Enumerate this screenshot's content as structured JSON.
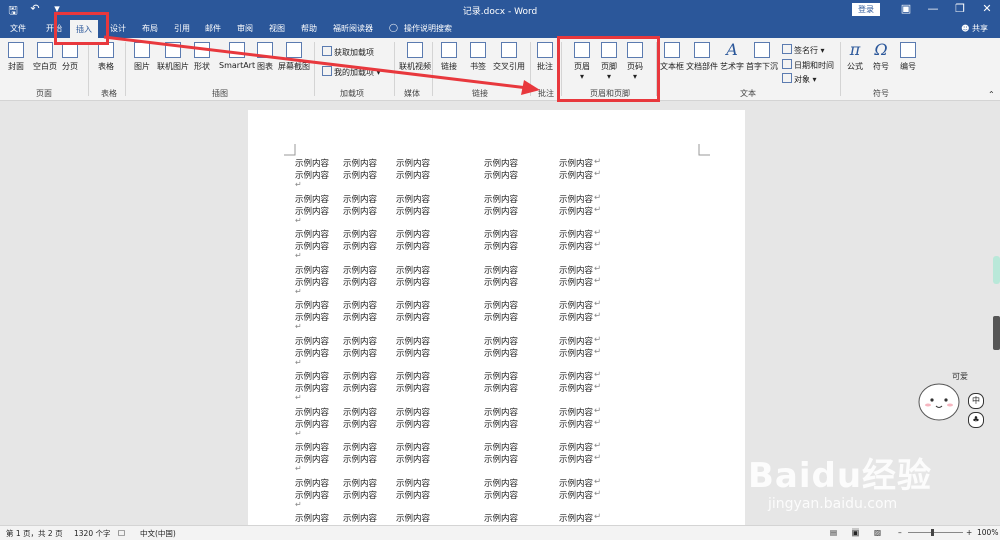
{
  "titlebar": {
    "title": "记录.docx - Word",
    "login": "登录",
    "qat_icons": [
      "save-icon",
      "undo-icon",
      "customize-icon"
    ]
  },
  "tabs": {
    "file": "文件",
    "home": "开始",
    "insert": "插入",
    "design": "设计",
    "layout": "布局",
    "references": "引用",
    "mailings": "邮件",
    "review": "审阅",
    "view": "视图",
    "help": "帮助",
    "foxit": "福昕阅读器",
    "tellme": "操作说明搜索",
    "share": "共享"
  },
  "ribbon": {
    "cover": "封面",
    "blank_page": "空白页",
    "page_break": "分页",
    "table": "表格",
    "picture": "图片",
    "online_picture": "联机图片",
    "shapes": "形状",
    "smartart": "SmartArt",
    "chart": "图表",
    "screenshot": "屏幕截图",
    "get_addins": "获取加载项",
    "my_addins": "我的加载项",
    "online_video": "联机视频",
    "link": "链接",
    "bookmark": "书签",
    "cross_ref": "交叉引用",
    "comment": "批注",
    "header": "页眉",
    "footer": "页脚",
    "page_number": "页码",
    "textbox": "文本框",
    "quick_parts": "文档部件",
    "wordart": "艺术字",
    "dropcap": "首字下沉",
    "signature": "签名行",
    "datetime": "日期和时间",
    "object": "对象",
    "equation": "公式",
    "symbol": "符号",
    "number": "编号",
    "groups": {
      "pages": "页面",
      "tables": "表格",
      "illustrations": "插图",
      "addins": "加载项",
      "media": "媒体",
      "links": "链接",
      "comments": "批注",
      "header_footer": "页眉和页脚",
      "text": "文本",
      "symbols": "符号"
    }
  },
  "document": {
    "cell_text": "示例内容",
    "row_count": 21
  },
  "statusbar": {
    "page": "第 1 页，共 2 页",
    "words": "1320 个字",
    "lang": "中文(中国)",
    "zoom": "100%"
  },
  "overlay": {
    "mascot_caption": "可爱",
    "badge_zh": "中",
    "watermark": "Baidu经验",
    "watermark_url": "jingyan.baidu.com"
  },
  "colors": {
    "word_blue": "#2b579a",
    "highlight_red": "#e8383d"
  }
}
